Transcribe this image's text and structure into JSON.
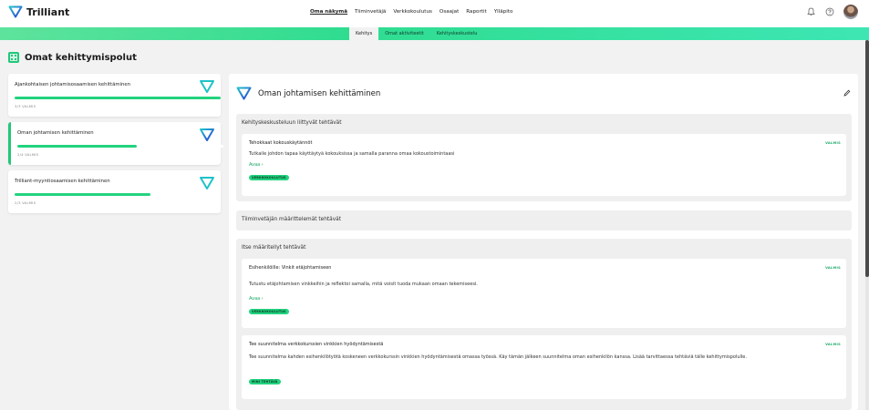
{
  "brand": {
    "name": "Trilliant"
  },
  "topnav": {
    "items": [
      "Oma näkymä",
      "Tiiminvetäjä",
      "Verkkokoulutus",
      "Osaajat",
      "Raportit",
      "Ylläpito"
    ],
    "active_index": 0
  },
  "topbar_icons": [
    "bell-icon",
    "help-icon",
    "avatar"
  ],
  "subtabs": {
    "items": [
      "Kehitys",
      "Omat aktiviteetit",
      "Kehityskeskustelu"
    ],
    "active_index": 0
  },
  "page": {
    "title": "Omat kehittymispolut"
  },
  "paths": [
    {
      "title": "Ajankohtaisen johtamisosaamisen kehittäminen",
      "status": "3/3 VALMIS",
      "progress": 1.0,
      "selected": false
    },
    {
      "title": "Oman johtamisen kehittäminen",
      "status": "2/4 VALMIS",
      "progress": 0.58,
      "selected": true
    },
    {
      "title": "Trilliant-myyntiosaamisen kehittäminen",
      "status": "2/3 VALMIS",
      "progress": 0.66,
      "selected": false
    }
  ],
  "main": {
    "title": "Oman johtamisen kehittäminen",
    "sections": [
      {
        "title": "Kehityskeskusteluun liittyvät tehtävät",
        "tasks": [
          {
            "title": "Tehokkaat kokouskäytännöt",
            "status": "VALMIS",
            "description": "Tutkaile johdon tapaa käyttäytyä kokouksissa ja samalla paranna omaa kokoustoimintaasi",
            "link": "Avaa  ›",
            "tag": "VERKKOKOULUTUS"
          }
        ]
      },
      {
        "title": "Tiiminvetäjän määrittelemät tehtävät",
        "tasks": []
      },
      {
        "title": "Itse määritellyt tehtävät",
        "tasks": [
          {
            "title": "Esihenkilöille: Vinkit etäjohtamiseen",
            "status": "VALMIS",
            "description": "Tutustu etäjohtamisen vinkkeihin ja reflektoi samalla, mitä voisit tuoda mukaan omaan tekemiseesi.",
            "link": "Avaa  ›",
            "tag": "VERKKOKOULUTUS"
          },
          {
            "title": "Tee suunnitelma verkkokurssien vinkkien hyödyntämisestä",
            "status": "VALMIS",
            "description": "Tee suunnitelma kahden esihenkilötyötä koskeneen verkkokurssin vinkkien hyödyntämisestä omassa työssä. Käy tämän jälkeen suunnitelma oman esihenkilön kanssa. Lisää tarvittaessa tehtäviä tälle kehittymispolulle.",
            "link": "",
            "tag": "MINI TEHTÄVÄ"
          }
        ]
      }
    ]
  },
  "colors": {
    "accent": "#22d37f",
    "accent_dark": "#18a868",
    "logo_blue": "#2a3bd6",
    "logo_teal": "#1fc2c9"
  }
}
